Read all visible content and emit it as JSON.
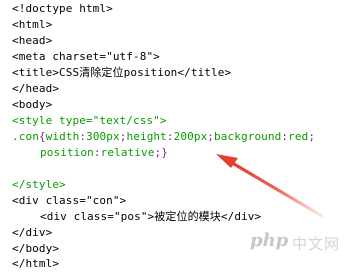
{
  "code": {
    "lines": [
      "<!doctype html>",
      "<html>",
      "<head>",
      "<meta charset=\"utf-8\">",
      "<title>CSS清除定位position</title>",
      "</head>",
      "<body>",
      "<style type=\"text/css\">",
      ".con{width:300px;height:200px;background:red;",
      "position:relative;}",
      "",
      "</style>",
      "<div class=\"con\">",
      "<div class=\"pos\">被定位的模块</div>",
      "</div>",
      "</body>",
      "</html>"
    ]
  },
  "annotation": {
    "arrow_color": "#e84a3a"
  },
  "watermark": {
    "logo": "php",
    "text": "中文网"
  },
  "colors": {
    "text_default": "#000000",
    "css_style_block": "#0a9a00",
    "css_separators": "#9a1ab0"
  }
}
